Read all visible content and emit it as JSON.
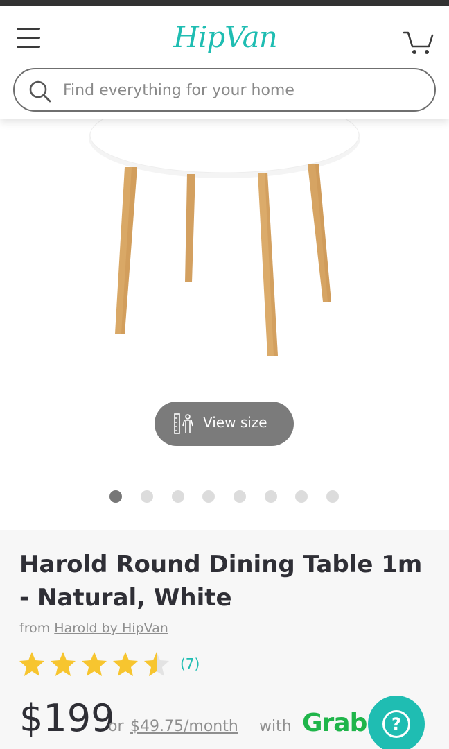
{
  "header": {
    "logo_text": "HipVan",
    "menu_icon": "hamburger-menu-icon",
    "cart_icon": "shopping-cart-icon"
  },
  "search": {
    "placeholder": "Find everything for your home",
    "icon": "search-icon"
  },
  "gallery": {
    "image_alt": "Harold Round Dining Table",
    "view_size_label": "View size",
    "view_size_icon": "ruler-person-icon",
    "dot_count": 8,
    "active_dot": 0
  },
  "product": {
    "title": "Harold Round Dining Table 1m - Natural, White",
    "from_prefix": "from",
    "brand": "Harold by HipVan",
    "rating": 4.5,
    "review_count": "(7)",
    "price": "$199",
    "or_text": "or",
    "monthly_price": "$49.75/month",
    "with_text": "with",
    "payment_provider": "Grab"
  },
  "help": {
    "icon": "question-mark-icon",
    "label": "?"
  },
  "colors": {
    "brand_teal": "#1fbdb2",
    "grab_green": "#1fb54a",
    "star_yellow": "#f7c52f",
    "text_dark": "#2f2f36",
    "text_muted": "#8f8f8f"
  }
}
